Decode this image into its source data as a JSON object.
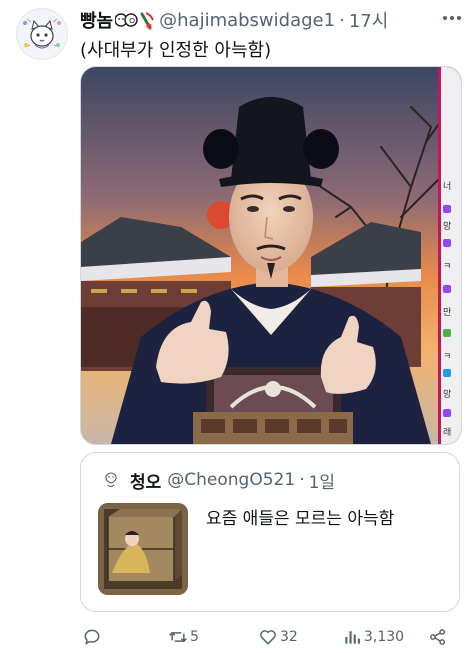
{
  "tweet": {
    "author": {
      "display_name": "빵놈",
      "handle": "@hajimabswidage1",
      "avatar_icon": "cat-avatar-icon"
    },
    "separator": "·",
    "time": "17시",
    "text": "(사대부가 인정한 아늑함)",
    "media_icon": "joseon-scholar-stream-image"
  },
  "quote": {
    "author": {
      "display_name": "청오",
      "handle": "@CheongO521",
      "avatar_icon": "sketch-avatar-icon"
    },
    "separator": "·",
    "time": "1일",
    "text": "요즘 애들은 모르는 아늑함",
    "thumbnail_icon": "wooden-box-room-image"
  },
  "actions": {
    "reply": {
      "icon": "reply-icon"
    },
    "retweet": {
      "icon": "retweet-icon",
      "count": "5"
    },
    "like": {
      "icon": "heart-icon",
      "count": "32"
    },
    "views": {
      "icon": "views-icon",
      "count": "3,130"
    },
    "share": {
      "icon": "share-icon"
    }
  },
  "colors": {
    "text": "#0f1419",
    "secondary": "#536471",
    "border": "#cfd9de",
    "sky_top": "#3d4663",
    "sunset": "#f08a44",
    "robe": "#1d2240",
    "stream_accent": "#c2185b"
  }
}
